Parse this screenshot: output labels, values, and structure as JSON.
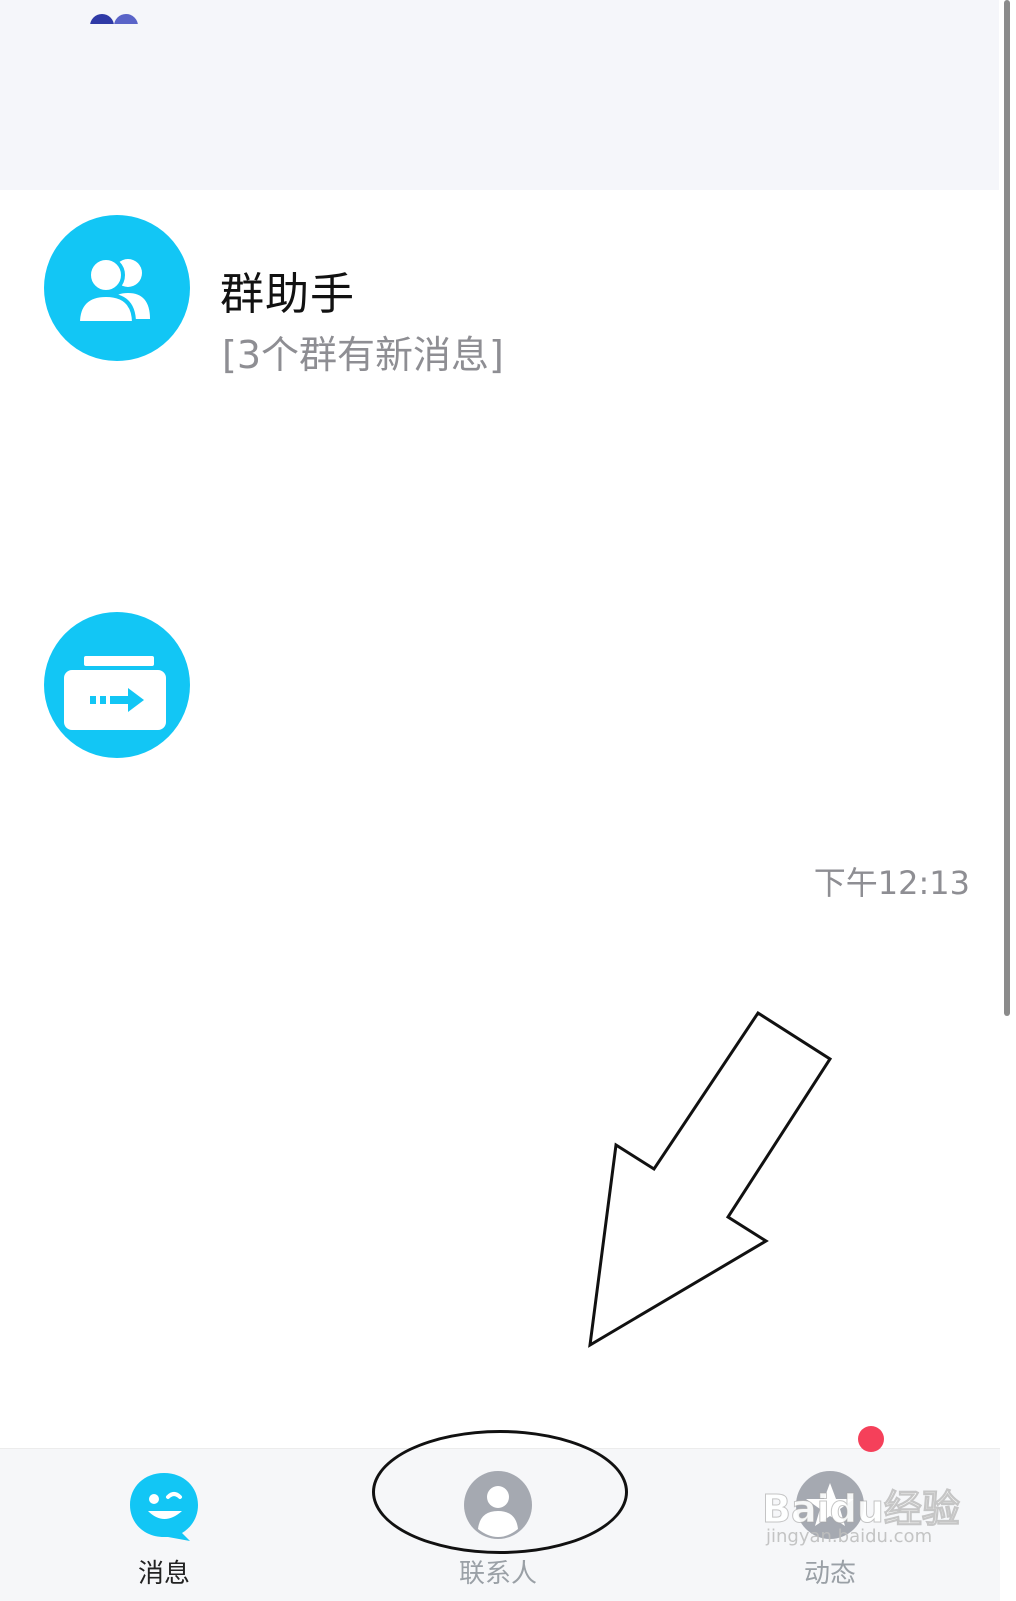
{
  "conversations": [
    {
      "title": "群助手",
      "subtitle": "[3个群有新消息]",
      "icon": "group-assistant-icon",
      "color": "#12c6f5"
    },
    {
      "title": "",
      "subtitle": "",
      "icon": "file-transfer-icon",
      "color": "#12c6f5",
      "time": "下午12:13"
    }
  ],
  "tabbar": {
    "tabs": [
      {
        "label": "消息",
        "icon": "messages-smiley-icon",
        "active": true
      },
      {
        "label": "联系人",
        "icon": "contacts-icon",
        "active": false
      },
      {
        "label": "动态",
        "icon": "moments-star-icon",
        "active": false,
        "badge": true
      }
    ],
    "active_color": "#12c6f5",
    "badge_color": "#f5405a"
  },
  "watermark": {
    "main": "Baidu经验",
    "sub": "jingyan.baidu.com"
  }
}
